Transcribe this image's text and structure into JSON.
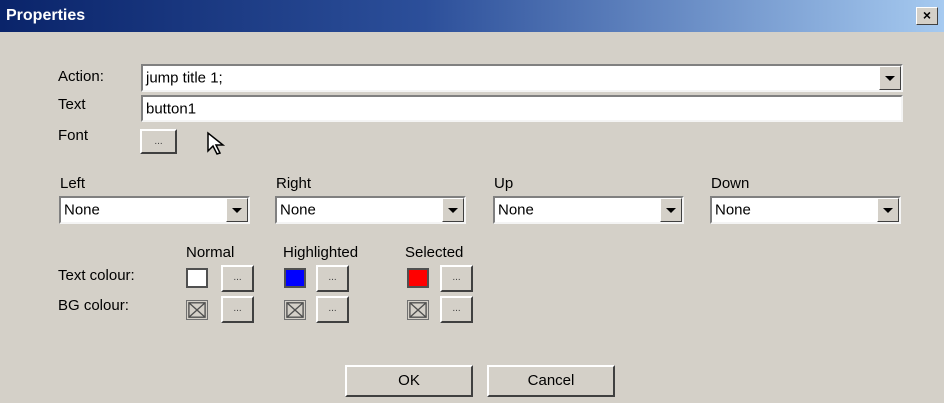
{
  "window": {
    "title": "Properties",
    "close_label": "×"
  },
  "fields": {
    "action_label": "Action:",
    "action_value": "jump title 1;",
    "text_label": "Text",
    "text_value": "button1",
    "font_label": "Font",
    "font_button": "..."
  },
  "navigation": [
    {
      "label": "Left",
      "value": "None"
    },
    {
      "label": "Right",
      "value": "None"
    },
    {
      "label": "Up",
      "value": "None"
    },
    {
      "label": "Down",
      "value": "None"
    }
  ],
  "colours": {
    "columns": [
      "Normal",
      "Highlighted",
      "Selected"
    ],
    "text_colour_label": "Text colour:",
    "bg_colour_label": "BG colour:",
    "picker_button": "...",
    "text_colours": [
      "#ffffff",
      "#0000ff",
      "#ff0000"
    ]
  },
  "buttons": {
    "ok": "OK",
    "cancel": "Cancel"
  }
}
